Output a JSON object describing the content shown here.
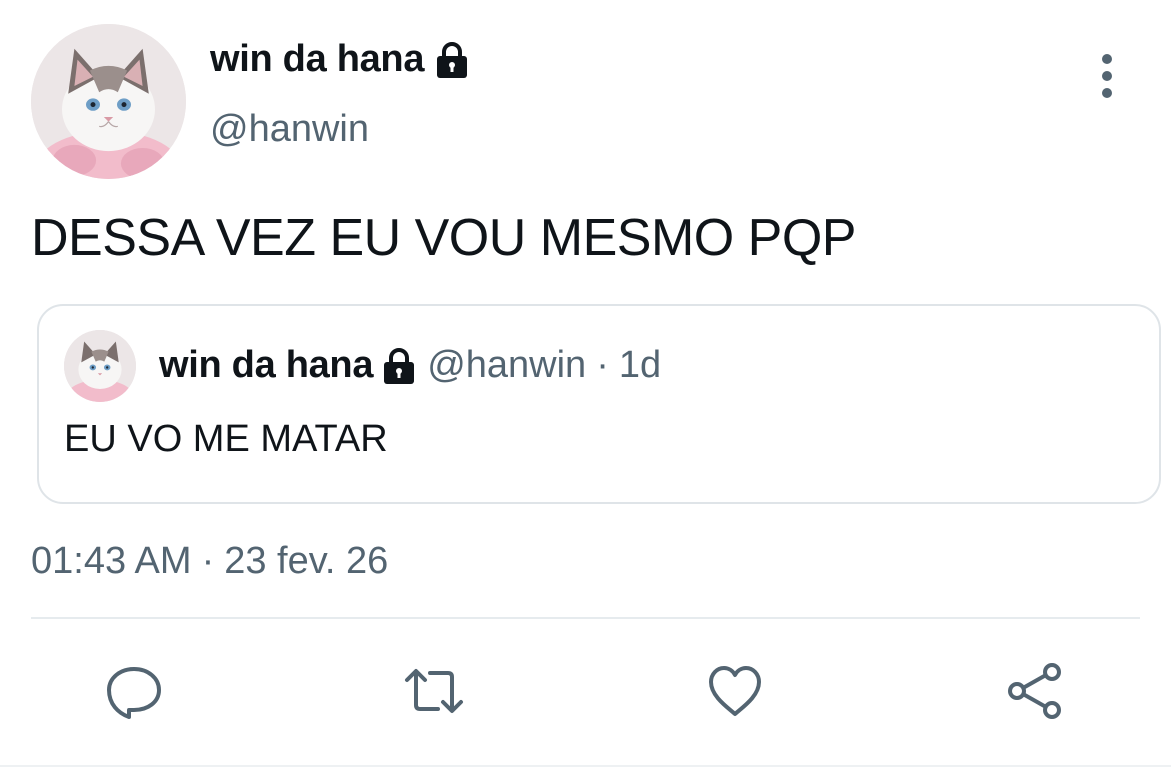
{
  "tweet": {
    "display_name": "win da hana",
    "handle": "@hanwin",
    "text": "DESSA VEZ EU VOU MESMO PQP",
    "timestamp": {
      "time": "01:43 AM",
      "separator": "·",
      "date": "23 fev. 26"
    }
  },
  "quoted_tweet": {
    "display_name": "win da hana",
    "handle": "@hanwin",
    "separator": "·",
    "time": "1d",
    "text": "EU VO ME MATAR"
  },
  "icons": {
    "protected": "lock-icon",
    "more": "more-vertical-icon",
    "reply": "reply-icon",
    "retweet": "retweet-icon",
    "like": "like-icon",
    "share": "share-icon"
  },
  "colors": {
    "text": "#0f1419",
    "secondary": "#536471",
    "border": "#dfe4e8"
  }
}
